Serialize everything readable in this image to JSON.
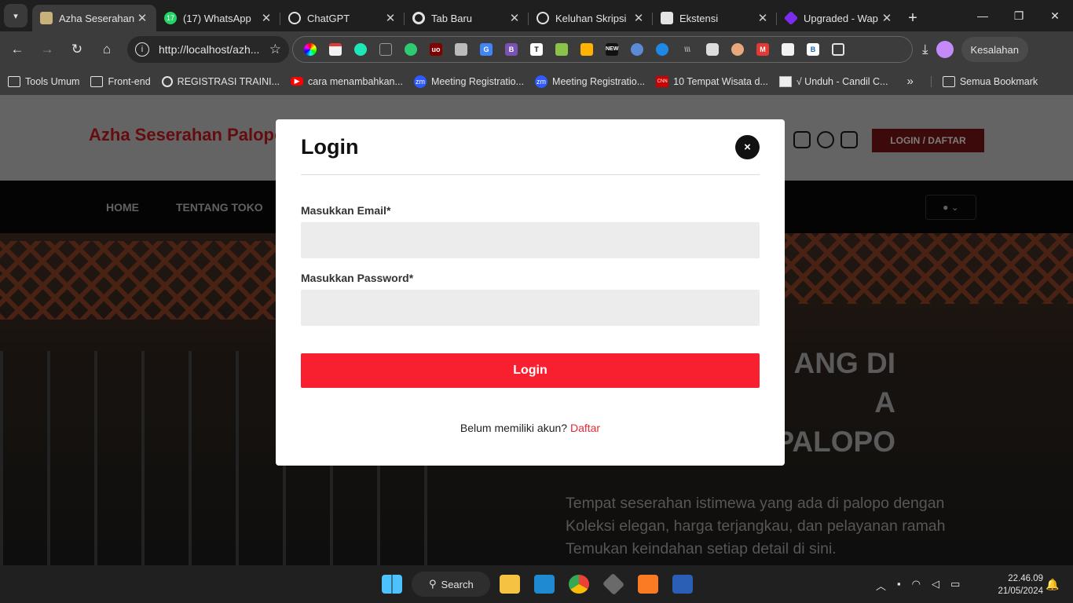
{
  "browser": {
    "tabs": [
      {
        "title": "Azha Seserahan",
        "active": true,
        "favicon": "azha-logo",
        "color": "#c9b27a"
      },
      {
        "title": "(17) WhatsApp",
        "active": false,
        "favicon": "whatsapp-icon",
        "color": "#25d366",
        "badge": "17"
      },
      {
        "title": "ChatGPT",
        "active": false,
        "favicon": "chatgpt-icon",
        "color": "#ffffff"
      },
      {
        "title": "Tab Baru",
        "active": false,
        "favicon": "chrome-icon",
        "color": "#e3e3e3"
      },
      {
        "title": "Keluhan Skripsi",
        "active": false,
        "favicon": "globe-icon",
        "color": "#e3e3e3"
      },
      {
        "title": "Ekstensi",
        "active": false,
        "favicon": "puzzle-icon",
        "color": "#e3e3e3"
      },
      {
        "title": "Upgraded - Wap",
        "active": false,
        "favicon": "wappalyzer-icon",
        "color": "#7b2cf0"
      }
    ],
    "url": "http://localhost/azh...",
    "error_button": "Kesalahan",
    "bookmarks": [
      {
        "label": "Tools Umum",
        "icon": "folder-icon"
      },
      {
        "label": "Front-end",
        "icon": "folder-icon"
      },
      {
        "label": "REGISTRASI TRAINI...",
        "icon": "globe-icon"
      },
      {
        "label": "cara menambahkan...",
        "icon": "youtube-icon"
      },
      {
        "label": "Meeting Registratio...",
        "icon": "zoom-icon",
        "glyph": "zm"
      },
      {
        "label": "Meeting Registratio...",
        "icon": "zoom-icon",
        "glyph": "zm"
      },
      {
        "label": "10 Tempat Wisata d...",
        "icon": "cnn-icon",
        "glyph": "CNN"
      },
      {
        "label": "√ Unduh - Candil C...",
        "icon": "page-icon"
      }
    ],
    "all_bookmarks": "Semua Bookmark"
  },
  "site": {
    "brand": "Azha Seserahan Palopo",
    "login_daftar": "LOGIN / DAFTAR",
    "nav": [
      "HOME",
      "TENTANG TOKO"
    ],
    "hero_title": "...ANG DI\n...A\n...PALOPO",
    "hero_title_lines": [
      "ANG DI",
      "A",
      "SESERAHAN PALOPO"
    ],
    "hero_desc": "Tempat seserahan istimewa yang ada di palopo dengan Koleksi elegan, harga terjangkau, dan pelayanan ramah Temukan keindahan setiap detail di sini."
  },
  "modal": {
    "title": "Login",
    "close": "×",
    "email_label": "Masukkan Email*",
    "email_value": "",
    "password_label": "Masukkan Password*",
    "password_value": "",
    "submit": "Login",
    "signup_text": "Belum memiliki akun?",
    "signup_link": "Daftar"
  },
  "taskbar": {
    "search": "Search",
    "time": "22.46.09",
    "date": "21/05/2024"
  },
  "colors": {
    "brand": "#7a0f12",
    "accent": "#f8202f",
    "link": "#e02b36"
  }
}
